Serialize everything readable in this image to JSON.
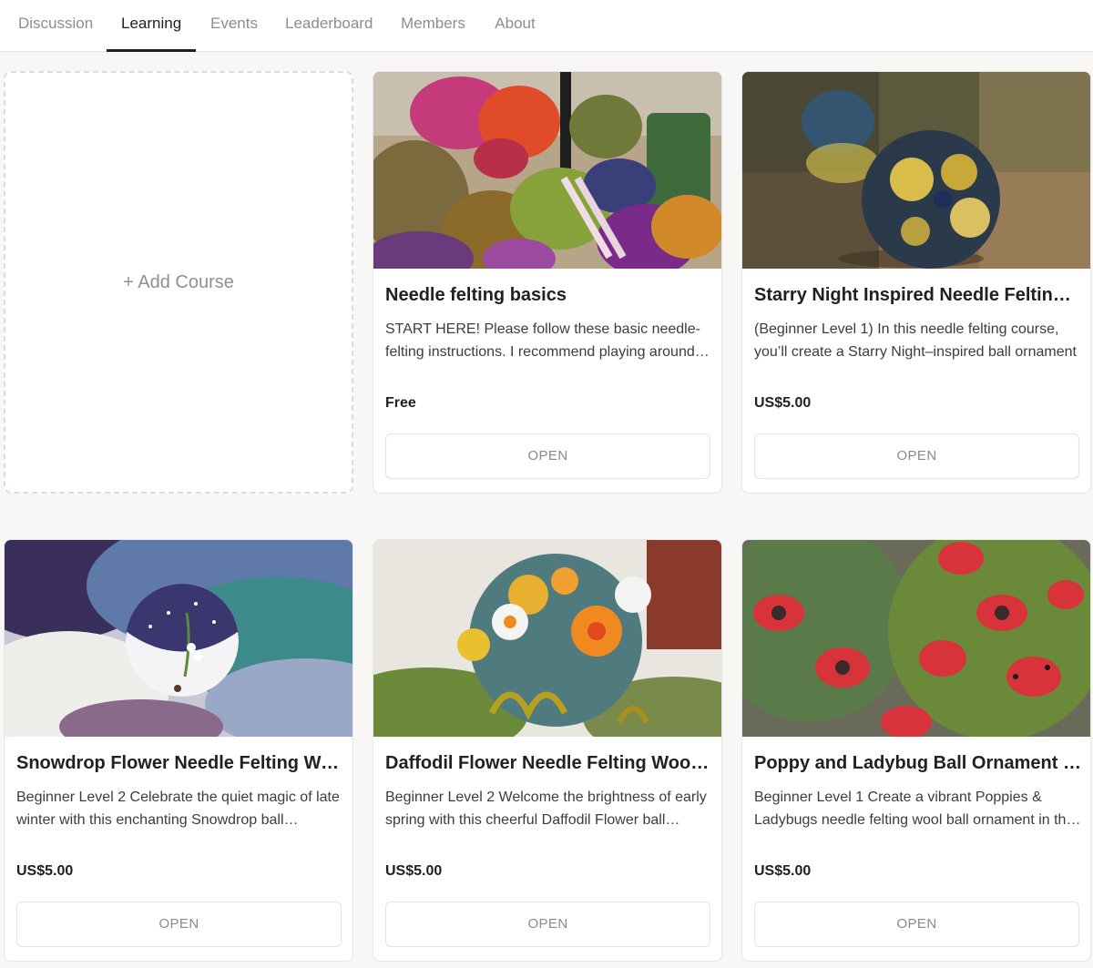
{
  "nav": {
    "tabs": [
      {
        "label": "Discussion",
        "active": false
      },
      {
        "label": "Learning",
        "active": true
      },
      {
        "label": "Events",
        "active": false
      },
      {
        "label": "Leaderboard",
        "active": false
      },
      {
        "label": "Members",
        "active": false
      },
      {
        "label": "About",
        "active": false
      }
    ]
  },
  "add_course": {
    "label": "+ Add Course"
  },
  "courses": [
    {
      "title": "Needle felting basics",
      "description": "START HERE! Please follow these basic needle-felting instructions. I recommend playing around with the wool",
      "price": "Free",
      "button": "OPEN",
      "image": "wool-supplies-photo"
    },
    {
      "title": "Starry Night Inspired Needle Felting Course",
      "description": "(Beginner Level 1) In this needle felting course, you’ll create a Starry Night–inspired ball ornament",
      "price": "US$5.00",
      "button": "OPEN",
      "image": "starry-ball-photo"
    },
    {
      "title": "Snowdrop Flower Needle Felting Wool Ball",
      "description": "Beginner Level 2 Celebrate the quiet magic of late winter with this enchanting Snowdrop ball ornament",
      "price": "US$5.00",
      "button": "OPEN",
      "image": "snowdrop-ball-photo"
    },
    {
      "title": "Daffodil Flower Needle Felting Wool Ball",
      "description": "Beginner Level 2 Welcome the brightness of early spring with this cheerful Daffodil Flower ball ornament",
      "price": "US$5.00",
      "button": "OPEN",
      "image": "daffodil-ball-photo"
    },
    {
      "title": "Poppy and Ladybug Ball Ornament - Beginner",
      "description": "Beginner Level 1 Create a vibrant Poppies & Ladybugs needle felting wool ball ornament in this course",
      "price": "US$5.00",
      "button": "OPEN",
      "image": "poppy-ladybug-photo"
    }
  ],
  "colors": {
    "background": "#f8f7f5",
    "card": "#ffffff",
    "active_tab": "#202124",
    "inactive_tab": "#8d8d8d",
    "button_text": "#8a8a8a"
  }
}
